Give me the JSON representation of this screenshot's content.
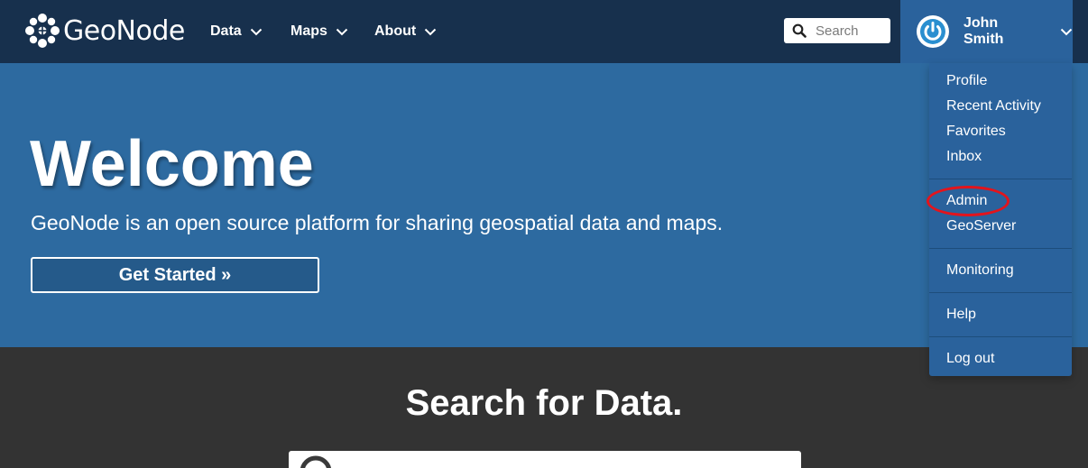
{
  "brand": {
    "name": "GeoNode",
    "logo_icon": "geonode-flower-icon"
  },
  "nav": {
    "data_label": "Data",
    "maps_label": "Maps",
    "about_label": "About"
  },
  "search": {
    "placeholder": "Search"
  },
  "user": {
    "name": "John Smith",
    "avatar_icon": "power-icon"
  },
  "hero": {
    "title": "Welcome",
    "subtitle": "GeoNode is an open source platform for sharing geospatial data and maps.",
    "cta_label": "Get Started »"
  },
  "search_section": {
    "title": "Search for Data."
  },
  "user_dropdown": {
    "items": [
      {
        "label": "Profile"
      },
      {
        "label": "Recent Activity"
      },
      {
        "label": "Favorites"
      },
      {
        "label": "Inbox"
      },
      {
        "label": "Admin",
        "highlighted": true
      },
      {
        "label": "GeoServer"
      },
      {
        "label": "Monitoring"
      },
      {
        "label": "Help"
      },
      {
        "label": "Log out"
      }
    ]
  },
  "colors": {
    "navbar": "#17304d",
    "hero": "#2d6aa0",
    "accent": "#2a629c",
    "dark_section": "#333333",
    "highlight": "#e3141c"
  }
}
